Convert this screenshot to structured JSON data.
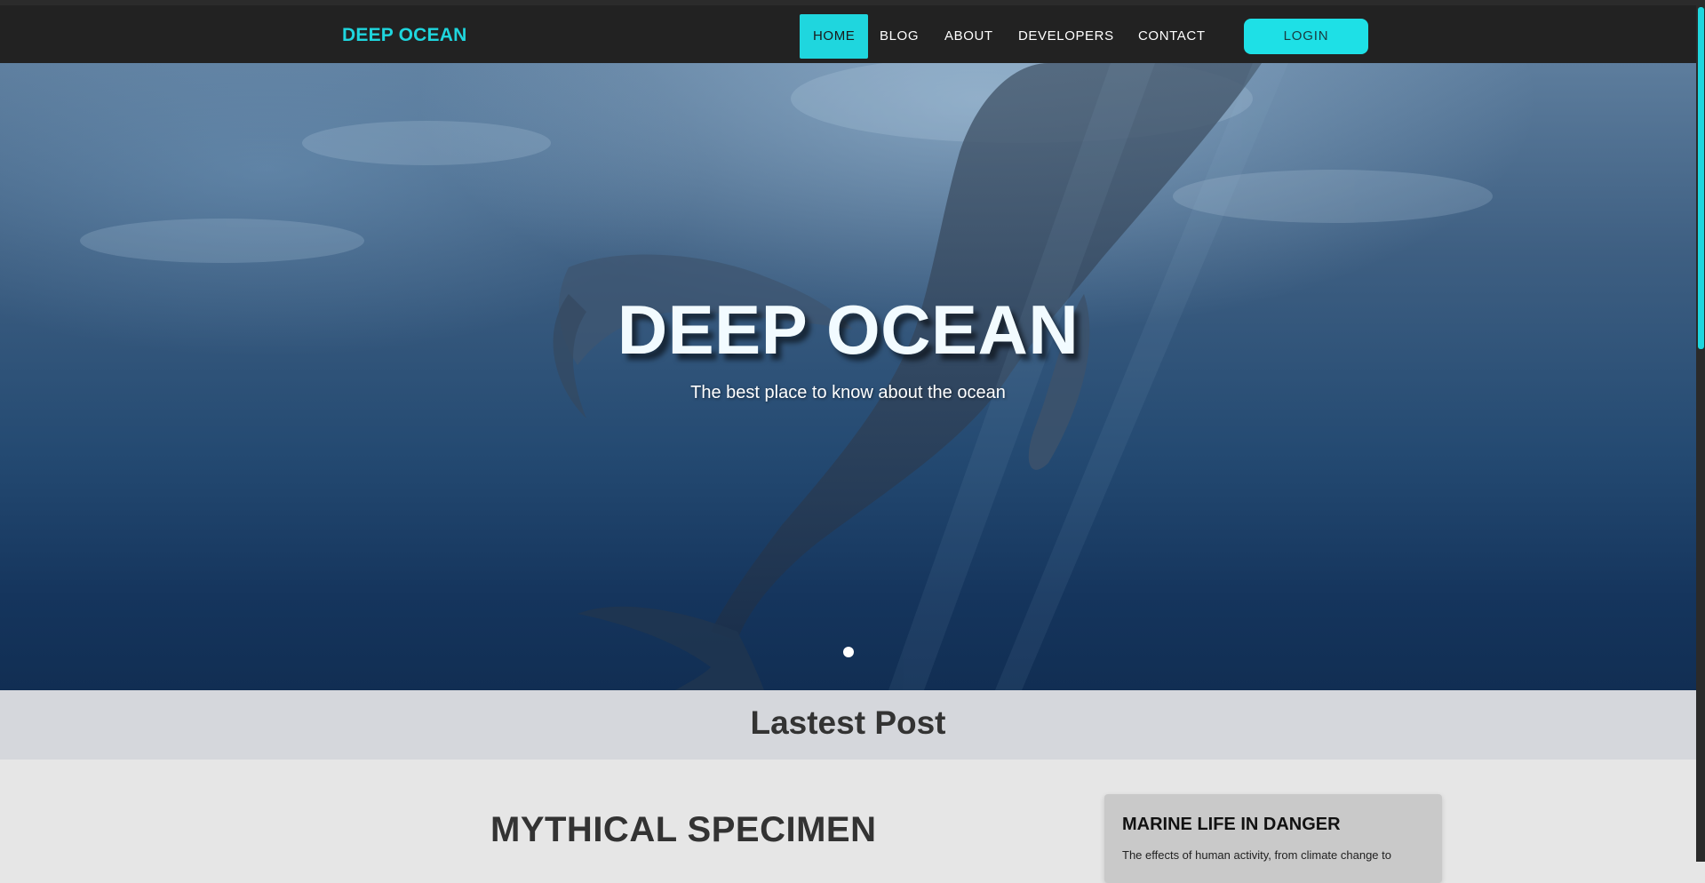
{
  "navbar": {
    "brand": "DEEP OCEAN",
    "items": [
      {
        "label": "HOME",
        "active": true
      },
      {
        "label": "BLOG"
      },
      {
        "label": "ABOUT"
      },
      {
        "label": "DEVELOPERS"
      },
      {
        "label": "CONTACT"
      }
    ],
    "login_label": "LOGIN"
  },
  "hero": {
    "title": "DEEP OCEAN",
    "subtitle": "The best place to know about the ocean",
    "carousel_slides": 1,
    "active_slide": 1
  },
  "latest": {
    "heading": "Lastest Post"
  },
  "main_post": {
    "title": "MYTHICAL SPECIMEN"
  },
  "side_card": {
    "title": "MARINE LIFE IN DANGER",
    "text": "The effects of human activity, from climate change to"
  },
  "colors": {
    "accent": "#1fd6de",
    "navbar_bg": "#222222",
    "band_bg": "#d5d7dc",
    "page_bg": "#e6e6e6"
  }
}
